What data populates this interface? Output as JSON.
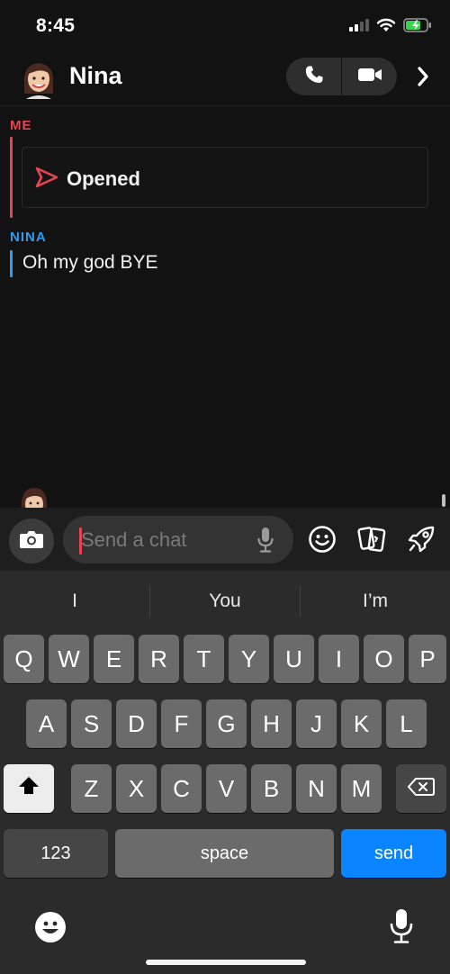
{
  "status_bar": {
    "time": "8:45",
    "icons": [
      "cellular-signal-icon",
      "wifi-icon",
      "battery-charging-icon"
    ]
  },
  "header": {
    "contact_name": "Nina",
    "icons": [
      "bitmoji-avatar-icon",
      "phone-icon",
      "video-camera-icon",
      "chevron-right-icon"
    ]
  },
  "messages": {
    "me_label": "ME",
    "opened_label": "Opened",
    "nina_label": "NINA",
    "nina_message": "Oh my god BYE"
  },
  "input": {
    "placeholder": "Send a chat",
    "icons": [
      "camera-icon",
      "microphone-icon",
      "smiley-icon",
      "cards-icon",
      "rocket-icon"
    ]
  },
  "keyboard": {
    "suggestions": [
      "I",
      "You",
      "I’m"
    ],
    "row1": [
      "Q",
      "W",
      "E",
      "R",
      "T",
      "Y",
      "U",
      "I",
      "O",
      "P"
    ],
    "row2": [
      "A",
      "S",
      "D",
      "F",
      "G",
      "H",
      "J",
      "K",
      "L"
    ],
    "row3": [
      "Z",
      "X",
      "C",
      "V",
      "B",
      "N",
      "M"
    ],
    "numbers_label": "123",
    "space_label": "space",
    "send_label": "send"
  },
  "colors": {
    "background": "#121212",
    "me_accent": "#e84352",
    "nina_accent": "#2f9cf0",
    "send_key": "#0a84ff",
    "key": "#6b6b6b",
    "keyboard_bg": "#2b2b2b"
  }
}
